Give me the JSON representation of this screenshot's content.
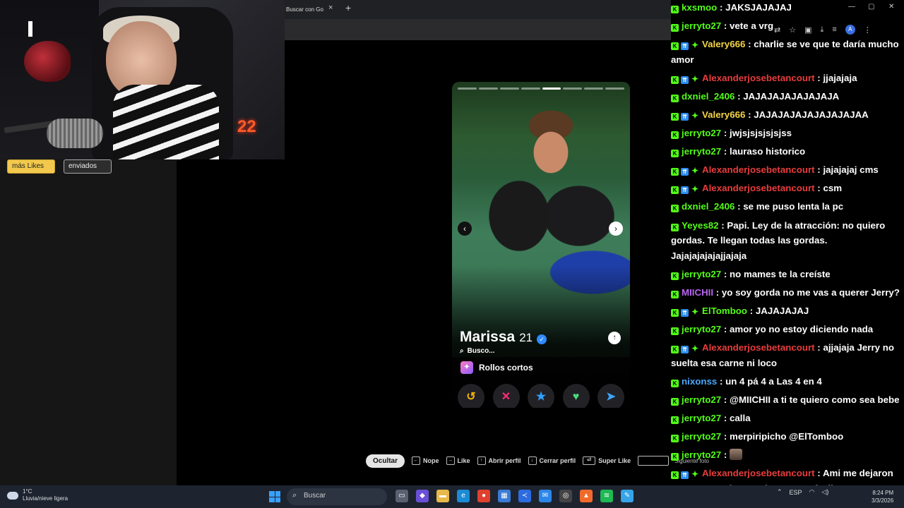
{
  "left_panel": {
    "tabs": [
      "más Likes",
      "enviados"
    ]
  },
  "webcam": {
    "led_text": "22"
  },
  "browser": {
    "tab_title": "Buscar con Go",
    "close_glyph": "×",
    "new_tab_glyph": "+",
    "profile_initial": "A",
    "toolbar_icons": [
      "translate-icon",
      "star-icon",
      "extensions-icon",
      "download-icon",
      "playlist-icon",
      "profile-icon",
      "menu-icon"
    ]
  },
  "profile": {
    "name": "Marissa",
    "age": "21",
    "looking_label": "Busco...",
    "intent": "Rollos cortos",
    "photo_count": 8,
    "active_photo": 5,
    "actions": [
      "rewind",
      "nope",
      "super-like",
      "like",
      "boost"
    ]
  },
  "hints": {
    "hide": "Ocultar",
    "items": [
      "Nope",
      "Like",
      "Abrir perfil",
      "Cerrar perfil",
      "Super Like"
    ],
    "next_photo": "Siguiente foto"
  },
  "chat": [
    {
      "user": "kxsmoo",
      "color": "#53fc18",
      "badges": [
        "k"
      ],
      "text": "JAKSJAJAJAJ"
    },
    {
      "user": "jerryto27",
      "color": "#53fc18",
      "badges": [
        "k"
      ],
      "text": "vete a vrg"
    },
    {
      "user": "Valery666",
      "color": "#f5d547",
      "badges": [
        "k",
        "b",
        "g"
      ],
      "text": "charlie se ve que te daría mucho amor"
    },
    {
      "user": "Alexanderjosebetancourt",
      "color": "#e83c3c",
      "badges": [
        "k",
        "b",
        "g"
      ],
      "text": "jjajajaja"
    },
    {
      "user": "dxniel_2406",
      "color": "#53fc18",
      "badges": [
        "k"
      ],
      "text": "JAJAJAJAJAJAJAJA"
    },
    {
      "user": "Valery666",
      "color": "#f5d547",
      "badges": [
        "k",
        "b",
        "g"
      ],
      "text": "JAJAJAJAJAJAJAJAJAA"
    },
    {
      "user": "jerryto27",
      "color": "#53fc18",
      "badges": [
        "k"
      ],
      "text": "jwjsjsjsjsjsjss"
    },
    {
      "user": "jerryto27",
      "color": "#53fc18",
      "badges": [
        "k"
      ],
      "text": "lauraso historico"
    },
    {
      "user": "Alexanderjosebetancourt",
      "color": "#e83c3c",
      "badges": [
        "k",
        "b",
        "g"
      ],
      "text": "jajajajaj cms"
    },
    {
      "user": "Alexanderjosebetancourt",
      "color": "#e83c3c",
      "badges": [
        "k",
        "b",
        "g"
      ],
      "text": "csm"
    },
    {
      "user": "dxniel_2406",
      "color": "#53fc18",
      "badges": [
        "k"
      ],
      "text": "se me puso lenta la pc"
    },
    {
      "user": "Yeyes82",
      "color": "#53fc18",
      "badges": [
        "k"
      ],
      "text": "Papi. Ley de la atracción: no quiero gordas. Te llegan todas las gordas. Jajajajajajajjajaja"
    },
    {
      "user": "jerryto27",
      "color": "#53fc18",
      "badges": [
        "k"
      ],
      "text": "no mames te la creíste"
    },
    {
      "user": "MIICHII",
      "color": "#b865f0",
      "badges": [
        "k"
      ],
      "text": "yo soy gorda no me vas a querer Jerry?"
    },
    {
      "user": "ElTomboo",
      "color": "#53fc18",
      "badges": [
        "k",
        "b",
        "g"
      ],
      "text": "JAJAJAJAJ"
    },
    {
      "user": "jerryto27",
      "color": "#53fc18",
      "badges": [
        "k"
      ],
      "text": "amor yo no estoy diciendo nada"
    },
    {
      "user": "Alexanderjosebetancourt",
      "color": "#e83c3c",
      "badges": [
        "k",
        "b",
        "g"
      ],
      "text": "ajjajaja Jerry no suelta esa carne ni loco"
    },
    {
      "user": "nixonss",
      "color": "#4aa8ff",
      "badges": [
        "k"
      ],
      "text": "un 4 pá 4 a Las 4 en 4"
    },
    {
      "user": "jerryto27",
      "color": "#53fc18",
      "badges": [
        "k"
      ],
      "text": "@MIICHII a ti te quiero como sea bebe"
    },
    {
      "user": "jerryto27",
      "color": "#53fc18",
      "badges": [
        "k"
      ],
      "text": "calla"
    },
    {
      "user": "jerryto27",
      "color": "#53fc18",
      "badges": [
        "k"
      ],
      "text": "merpiripicho @ElTomboo"
    },
    {
      "user": "jerryto27",
      "color": "#53fc18",
      "badges": [
        "k"
      ],
      "text": "",
      "emote": true
    },
    {
      "user": "Alexanderjosebetancourt",
      "color": "#e83c3c",
      "badges": [
        "k",
        "b",
        "g"
      ],
      "text": "Ami me dejaron con traumas lo q te viene no TA facil"
    }
  ],
  "taskbar": {
    "temp": "1°C",
    "weather": "Lluvia/nieve ligera",
    "search": "Buscar",
    "lang": "ESP",
    "time": "8:24 PM",
    "date": "3/3/2026"
  }
}
